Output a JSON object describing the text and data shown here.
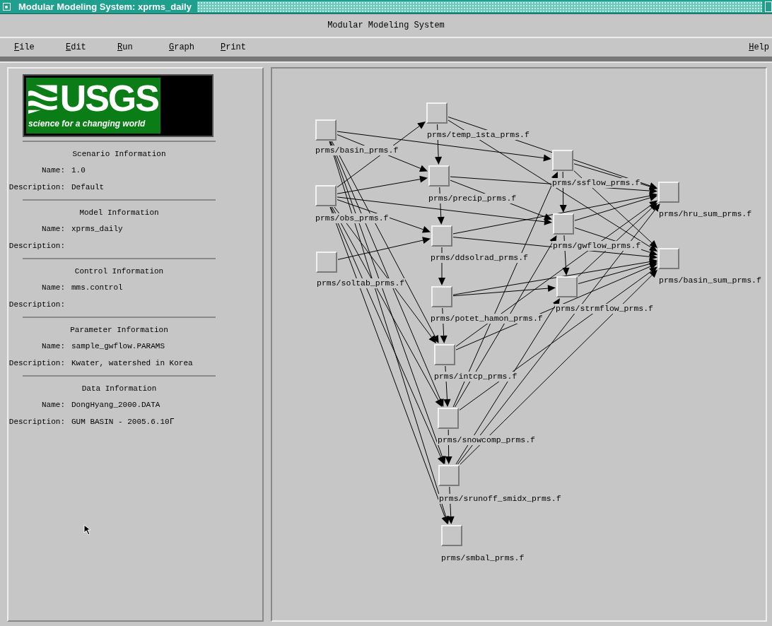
{
  "window": {
    "title": "Modular Modeling System: xprms_daily"
  },
  "app_header": "Modular Modeling System",
  "menu": [
    {
      "label": "File"
    },
    {
      "label": "Edit"
    },
    {
      "label": "Run"
    },
    {
      "label": "Graph"
    },
    {
      "label": "Print"
    },
    {
      "label": "Help"
    }
  ],
  "logo": {
    "wordmark": "USGS",
    "tagline": "science for a changing world"
  },
  "info_sections": [
    {
      "heading": "Scenario Information",
      "fields": [
        {
          "label": "Name:",
          "value": "1.0"
        },
        {
          "label": "Description:",
          "value": "Default"
        }
      ]
    },
    {
      "heading": "Model Information",
      "fields": [
        {
          "label": "Name:",
          "value": "xprms_daily"
        },
        {
          "label": "Description:"
        }
      ]
    },
    {
      "heading": "Control Information",
      "fields": [
        {
          "label": "Name:",
          "value": "mms.control"
        },
        {
          "label": "Description:"
        }
      ]
    },
    {
      "heading": "Parameter Information",
      "fields": [
        {
          "label": "Name:",
          "value": "sample_gwflow.PARAMS"
        },
        {
          "label": "Description:",
          "value": "Kwater, watershed in Korea"
        }
      ]
    },
    {
      "heading": "Data Information",
      "fields": [
        {
          "label": "Name:",
          "value": "DongHyang_2000.DATA"
        },
        {
          "label": "Description:",
          "value": "GUM BASIN - 2005.6.10ᒥ"
        }
      ]
    }
  ],
  "graph": {
    "nodes": [
      {
        "label": "prms/basin_prms.f"
      },
      {
        "label": "prms/obs_prms.f"
      },
      {
        "label": "prms/soltab_prms.f"
      },
      {
        "label": "prms/temp_1sta_prms.f"
      },
      {
        "label": "prms/precip_prms.f"
      },
      {
        "label": "prms/ddsolrad_prms.f"
      },
      {
        "label": "prms/potet_hamon_prms.f"
      },
      {
        "label": "prms/intcp_prms.f"
      },
      {
        "label": "prms/snowcomp_prms.f"
      },
      {
        "label": "prms/srunoff_smidx_prms.f"
      },
      {
        "label": "prms/smbal_prms.f"
      },
      {
        "label": "prms/ssflow_prms.f"
      },
      {
        "label": "prms/gwflow_prms.f"
      },
      {
        "label": "prms/strmflow_prms.f"
      },
      {
        "label": "prms/hru_sum_prms.f"
      },
      {
        "label": "prms/basin_sum_prms.f"
      }
    ]
  }
}
